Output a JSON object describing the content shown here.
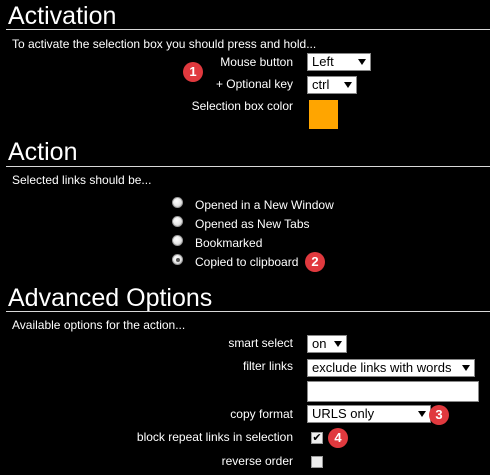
{
  "activation": {
    "title": "Activation",
    "description": "To activate the selection box you should press and hold...",
    "mouse_button_label": "Mouse button",
    "mouse_button_value": "Left",
    "optional_key_label": "+ Optional key",
    "optional_key_value": "ctrl",
    "color_label": "Selection box color",
    "color_value": "#FFA500",
    "badge": "1"
  },
  "action": {
    "title": "Action",
    "description": "Selected links should be...",
    "options": [
      {
        "label": "Opened in a New Window",
        "checked": false
      },
      {
        "label": "Opened as New Tabs",
        "checked": false
      },
      {
        "label": "Bookmarked",
        "checked": false
      },
      {
        "label": "Copied to clipboard",
        "checked": true
      }
    ],
    "badge": "2"
  },
  "advanced": {
    "title": "Advanced Options",
    "description": "Available options for the action...",
    "smart_select_label": "smart select",
    "smart_select_value": "on",
    "filter_links_label": "filter links",
    "filter_links_value": "exclude links with words",
    "filter_words_value": "",
    "copy_format_label": "copy format",
    "copy_format_value": "URLS only",
    "copy_format_badge": "3",
    "block_repeat_label": "block repeat links in selection",
    "block_repeat_checked": true,
    "block_repeat_badge": "4",
    "reverse_order_label": "reverse order",
    "reverse_order_checked": false
  },
  "colors": {
    "background": "#000000",
    "badge": "#E0393E",
    "rule": "#D8D8D8"
  }
}
